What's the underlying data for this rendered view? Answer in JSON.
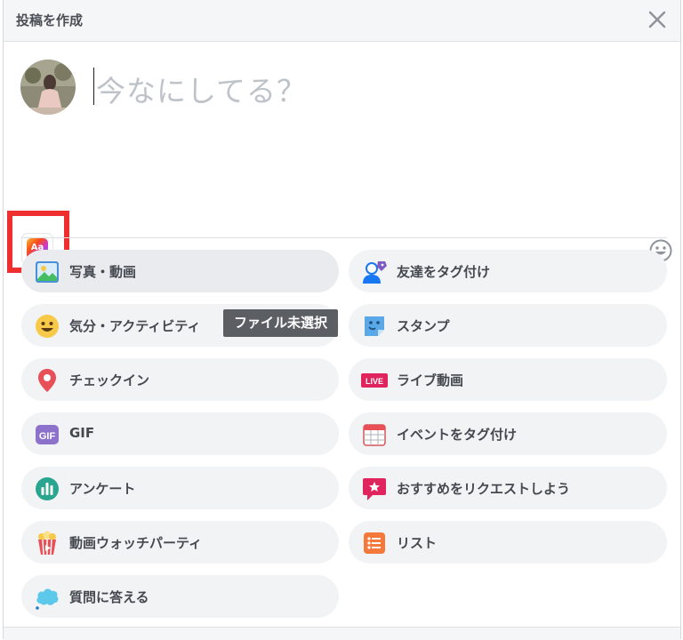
{
  "header": {
    "title": "投稿を作成"
  },
  "composer": {
    "placeholder": "今なにしてる？",
    "bg_button_label": "Aa"
  },
  "options_left": [
    {
      "label": "写真・動画",
      "icon": "photo-icon"
    },
    {
      "label": "気分・アクティビティ",
      "icon": "smiley-face-icon"
    },
    {
      "label": "チェックイン",
      "icon": "location-pin-icon"
    },
    {
      "label": "GIF",
      "icon": "gif-icon"
    },
    {
      "label": "アンケート",
      "icon": "poll-chart-icon"
    },
    {
      "label": "動画ウォッチパーティ",
      "icon": "popcorn-icon"
    },
    {
      "label": "質問に答える",
      "icon": "speech-cloud-icon"
    }
  ],
  "options_right": [
    {
      "label": "友達をタグ付け",
      "icon": "tag-friend-icon"
    },
    {
      "label": "スタンプ",
      "icon": "sticker-icon"
    },
    {
      "label": "ライブ動画",
      "icon": "live-badge-icon",
      "badge": "LIVE"
    },
    {
      "label": "イベントをタグ付け",
      "icon": "calendar-icon"
    },
    {
      "label": "おすすめをリクエストしよう",
      "icon": "recommendation-star-icon"
    },
    {
      "label": "リスト",
      "icon": "list-icon"
    }
  ],
  "tooltip": {
    "text": "ファイル未選択"
  },
  "colors": {
    "highlight": "#ee2f2f",
    "option_bg": "#f2f3f5",
    "placeholder": "#bec3c9"
  }
}
